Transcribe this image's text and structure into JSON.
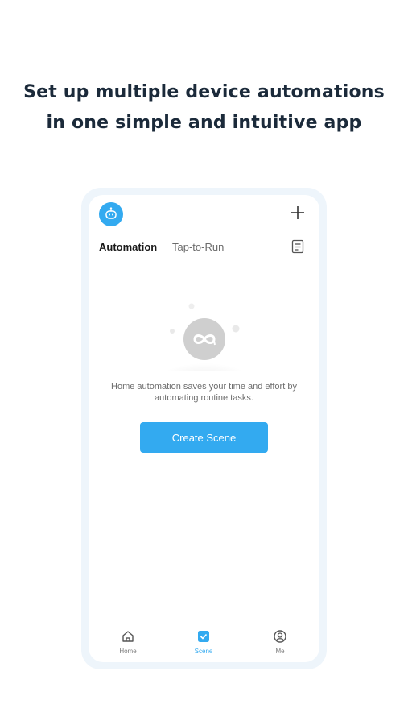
{
  "headline": {
    "line1": "Set up multiple device automations",
    "line2": "in one simple and intuitive app"
  },
  "header": {
    "avatar_icon": "robot-avatar-icon",
    "add_icon": "plus-icon"
  },
  "tabs": [
    {
      "label": "Automation",
      "active": true
    },
    {
      "label": "Tap-to-Run",
      "active": false
    }
  ],
  "log_icon": "log-document-icon",
  "empty_state": {
    "icon": "automation-loop-icon",
    "message": "Home automation saves your time and effort by automating routine tasks."
  },
  "create_button": {
    "label": "Create Scene"
  },
  "bottom_nav": [
    {
      "label": "Home",
      "icon": "home-icon",
      "active": false
    },
    {
      "label": "Scene",
      "icon": "scene-check-icon",
      "active": true
    },
    {
      "label": "Me",
      "icon": "profile-icon",
      "active": false
    }
  ],
  "colors": {
    "accent": "#33aaf0",
    "headline": "#1b2a3a",
    "phone_frame": "#eef5fb"
  }
}
